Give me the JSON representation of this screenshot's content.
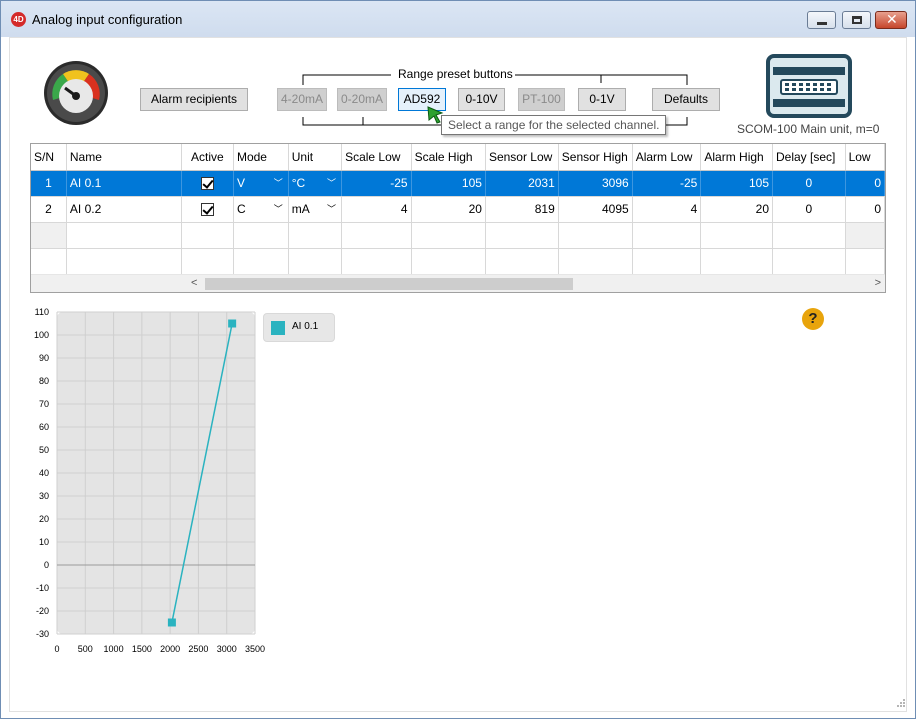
{
  "window": {
    "title": "Analog input configuration",
    "app_icon_text": "4D"
  },
  "toolbar": {
    "alarm_recipients_label": "Alarm recipients",
    "range_preset_label": "Range preset buttons",
    "presets": [
      {
        "label": "4-20mA",
        "enabled": false
      },
      {
        "label": "0-20mA",
        "enabled": false
      },
      {
        "label": "AD592",
        "enabled": true,
        "focused": true
      },
      {
        "label": "0-10V",
        "enabled": true
      },
      {
        "label": "PT-100",
        "enabled": false
      },
      {
        "label": "0-1V",
        "enabled": true
      },
      {
        "label": "Defaults",
        "enabled": true
      }
    ],
    "tooltip": "Select a range for the selected channel.",
    "device_label": "SCOM-100 Main unit, m=0"
  },
  "table": {
    "columns": [
      "S/N",
      "Name",
      "Active",
      "Mode",
      "Unit",
      "Scale Low",
      "Scale High",
      "Sensor Low",
      "Sensor High",
      "Alarm Low",
      "Alarm High",
      "Delay [sec]",
      "Low"
    ],
    "rows": [
      {
        "sn": "1",
        "name": "AI 0.1",
        "active": true,
        "mode": "V",
        "unit": "°C",
        "scale_low": "-25",
        "scale_high": "105",
        "sensor_low": "2031",
        "sensor_high": "3096",
        "alarm_low": "-25",
        "alarm_high": "105",
        "delay": "0",
        "low": "0",
        "selected": true
      },
      {
        "sn": "2",
        "name": "AI 0.2",
        "active": true,
        "mode": "C",
        "unit": "mA",
        "scale_low": "4",
        "scale_high": "20",
        "sensor_low": "819",
        "sensor_high": "4095",
        "alarm_low": "4",
        "alarm_high": "20",
        "delay": "0",
        "low": "0",
        "selected": false
      }
    ]
  },
  "chart_data": {
    "type": "line",
    "series": [
      {
        "name": "AI 0.1",
        "color": "#2ab3c0",
        "points": [
          [
            2031,
            -25
          ],
          [
            3096,
            105
          ]
        ]
      }
    ],
    "xlim": [
      0,
      3500
    ],
    "ylim": [
      -30,
      110
    ],
    "xticks": [
      0,
      500,
      1000,
      1500,
      2000,
      2500,
      3000,
      3500
    ],
    "yticks": [
      110,
      100,
      90,
      80,
      70,
      60,
      50,
      40,
      30,
      20,
      10,
      0,
      -10,
      -20,
      -30
    ],
    "grid": true,
    "legend": "right"
  },
  "help": {
    "label": "?"
  },
  "colors": {
    "selection": "#0078d7",
    "series": "#2ab3c0",
    "help": "#e8a40c"
  }
}
